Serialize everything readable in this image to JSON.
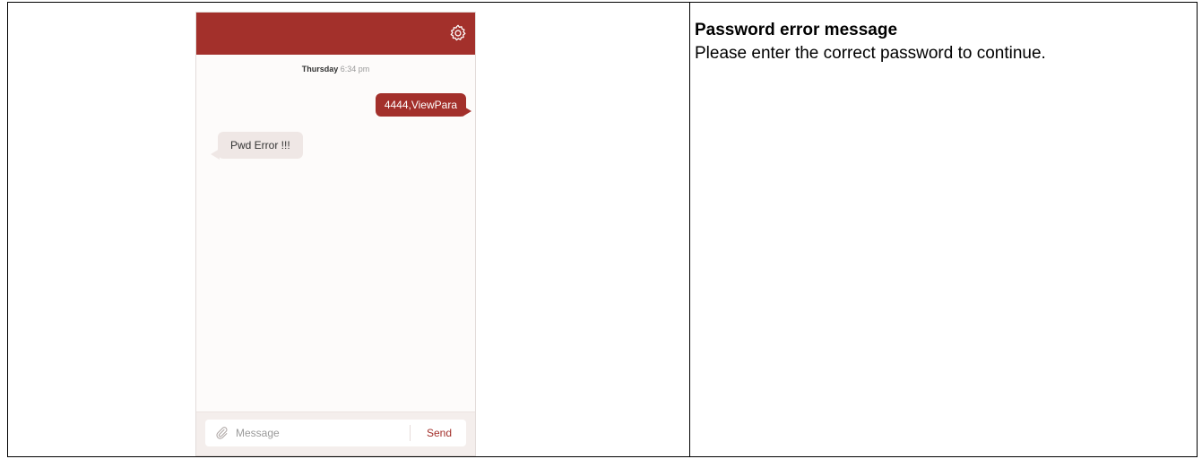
{
  "phone": {
    "header": {
      "settings_icon": "gear-icon",
      "color": "#a3302b"
    },
    "timestamp": {
      "day": "Thursday",
      "time": "6:34 pm"
    },
    "messages": [
      {
        "direction": "outgoing",
        "text": "4444,ViewPara"
      },
      {
        "direction": "incoming",
        "text": "Pwd Error !!!"
      }
    ],
    "composer": {
      "attach_icon": "paperclip-icon",
      "placeholder": "Message",
      "send_label": "Send"
    }
  },
  "description": {
    "title": "Password error message",
    "body": "Please enter the correct password to continue."
  }
}
